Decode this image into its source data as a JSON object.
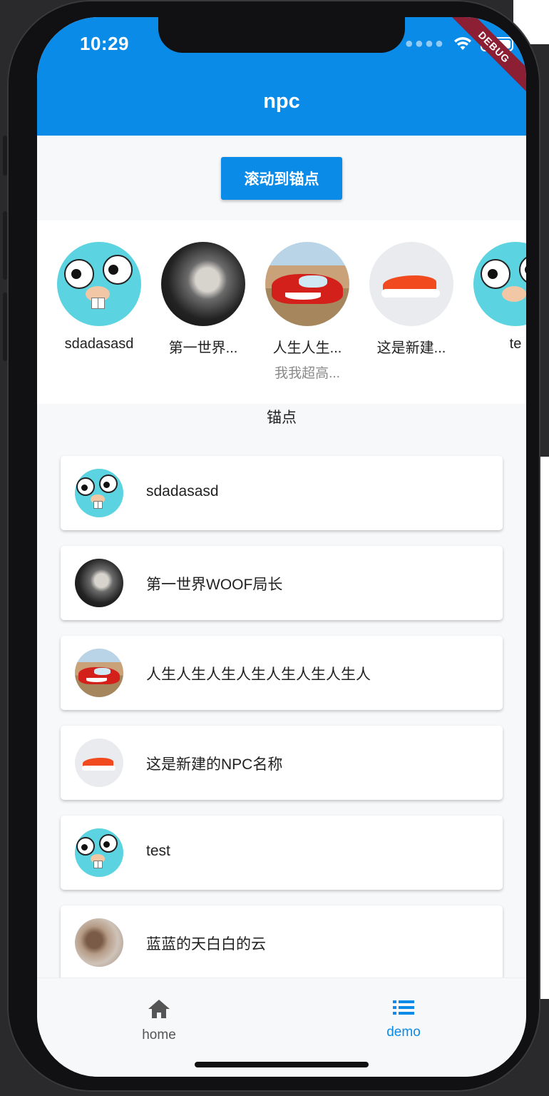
{
  "status_bar": {
    "time": "10:29",
    "debug_banner": "DEBUG",
    "wifi_icon": "wifi-icon",
    "battery_icon": "battery-icon"
  },
  "app_bar": {
    "title": "npc"
  },
  "scroll_button": {
    "label": "滚动到锚点"
  },
  "npc_strip": {
    "items": [
      {
        "name": "sdadasasd",
        "subtitle": "",
        "avatar": "gopher"
      },
      {
        "name": "第一世界...",
        "subtitle": "",
        "avatar": "anime"
      },
      {
        "name": "人生人生...",
        "subtitle": "我我超高...",
        "avatar": "car"
      },
      {
        "name": "这是新建...",
        "subtitle": "",
        "avatar": "shoe"
      },
      {
        "name": "te",
        "subtitle": "",
        "avatar": "gopher"
      }
    ]
  },
  "anchor": {
    "label": "锚点"
  },
  "npc_list": {
    "items": [
      {
        "name": "sdadasasd",
        "avatar": "gopher"
      },
      {
        "name": "第一世界WOOF局长",
        "avatar": "anime"
      },
      {
        "name": "人生人生人生人生人生人生人生人",
        "avatar": "car"
      },
      {
        "name": "这是新建的NPC名称",
        "avatar": "shoe"
      },
      {
        "name": "test",
        "avatar": "gopher"
      },
      {
        "name": "蓝蓝的天白白的云",
        "avatar": "kids"
      }
    ]
  },
  "bottom_nav": {
    "items": [
      {
        "label": "home",
        "icon": "home-icon",
        "active": false
      },
      {
        "label": "demo",
        "icon": "list-icon",
        "active": true
      }
    ]
  },
  "colors": {
    "primary": "#0a8be8",
    "inactive": "#555555",
    "background": "#f7f8fa"
  }
}
